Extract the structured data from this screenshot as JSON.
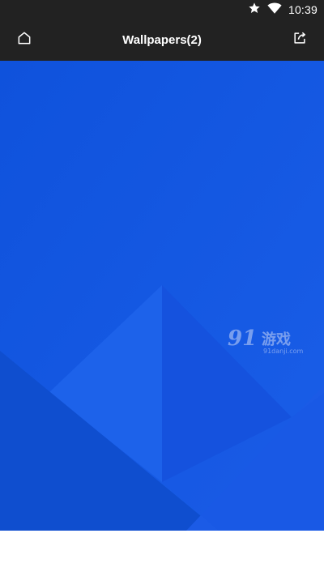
{
  "status_bar": {
    "time": "10:39",
    "icons": [
      "star-icon",
      "wifi-icon",
      "battery-icon"
    ]
  },
  "app_bar": {
    "title": "Wallpapers(2)",
    "left_icon": "home-icon",
    "right_icon": "share-icon"
  },
  "wallpaper": {
    "background_color": "#1456e0",
    "watermark": {
      "logo": "91",
      "name_cn": "游戏",
      "url": "91danji.com"
    }
  },
  "colors": {
    "bar_background": "#222222",
    "text_on_bar": "#ffffff"
  }
}
